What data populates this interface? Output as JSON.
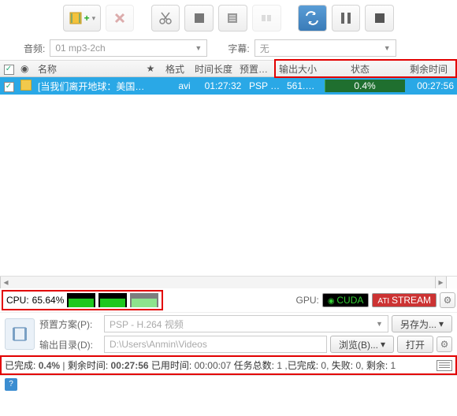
{
  "toolbar": {
    "audio_label": "音频:",
    "audio_value": "01 mp3-2ch",
    "subtitle_label": "字幕:",
    "subtitle_value": "无"
  },
  "columns": {
    "name": "名称",
    "star": "★",
    "format": "格式",
    "length": "时间长度",
    "preset": "预置方案",
    "size": "输出大小",
    "status": "状态",
    "remain": "剩余时间"
  },
  "task": {
    "checked": true,
    "name": "[当我们离开地球：美国国家...",
    "format": "avi",
    "length": "01:27:32",
    "preset": "PSP - ...",
    "size": "561.0 ...",
    "status_pct": "0.4%",
    "remain": "00:27:56"
  },
  "cpu": {
    "label": "CPU:",
    "pct": "65.64%"
  },
  "gpu": {
    "label": "GPU:",
    "nvidia": "CUDA",
    "ati": "STREAM"
  },
  "preset": {
    "label": "预置方案(P):",
    "value": "PSP - H.264 视频",
    "saveas": "另存为..."
  },
  "output": {
    "label": "输出目录(D):",
    "value": "D:\\Users\\Anmin\\Videos",
    "browse": "浏览(B)...",
    "open": "打开"
  },
  "status": {
    "done_l": "已完成:",
    "done_v": "0.4%",
    "rem_l": "剩余时间:",
    "rem_v": "00:27:56",
    "used_l": "已用时间:",
    "used_v": "00:00:07",
    "tot_l": "任务总数:",
    "tot_v": "1",
    "comp_l": "已完成:",
    "comp_v": "0",
    "fail_l": "失败:",
    "fail_v": "0",
    "left_l": "剩余:",
    "left_v": "1"
  }
}
